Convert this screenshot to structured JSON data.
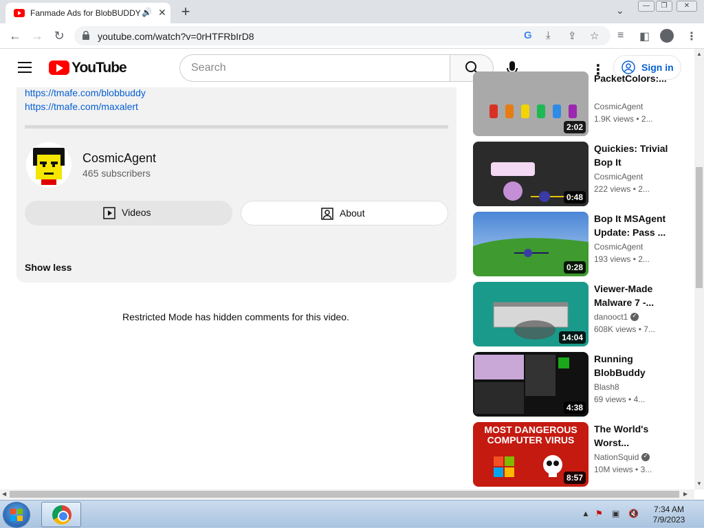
{
  "browser": {
    "tab_title": "Fanmade Ads for BlobBUDDY",
    "url": "youtube.com/watch?v=0rHTFRbIrD8",
    "new_tab_glyph": "+",
    "tab_close_glyph": "✕",
    "tab_audio_glyph": "🔊"
  },
  "youtube": {
    "logo_text": "YouTube",
    "search_placeholder": "Search",
    "signin_label": "Sign in"
  },
  "description": {
    "links": [
      "https://tmafe.com/blobbuddy",
      "https://tmafe.com/maxalert"
    ],
    "channel_name": "CosmicAgent",
    "subscribers": "465 subscribers",
    "videos_label": "Videos",
    "about_label": "About",
    "show_less_label": "Show less"
  },
  "comments": {
    "restricted_message": "Restricted Mode has hidden comments for this video."
  },
  "recommendations": [
    {
      "title": "PacketColors:...",
      "channel": "CosmicAgent",
      "views": "1.9K views",
      "age": "2...",
      "duration": "2:02",
      "verified": false
    },
    {
      "title": "Quickies: Trivial Bop It",
      "channel": "CosmicAgent",
      "views": "222 views",
      "age": "2...",
      "duration": "0:48",
      "verified": false
    },
    {
      "title": "Bop It MSAgent Update: Pass ...",
      "channel": "CosmicAgent",
      "views": "193 views",
      "age": "2...",
      "duration": "0:28",
      "verified": false
    },
    {
      "title": "Viewer-Made Malware 7 -...",
      "channel": "danooct1",
      "views": "608K views",
      "age": "7...",
      "duration": "14:04",
      "verified": true
    },
    {
      "title": "Running BlobBuddy",
      "channel": "Blash8",
      "views": "69 views",
      "age": "4...",
      "duration": "4:38",
      "verified": false
    },
    {
      "title": "The World's Worst...",
      "channel": "NationSquid",
      "views": "10M views",
      "age": "3...",
      "duration": "8:57",
      "verified": true,
      "thumb_text": "MOST DANGEROUS COMPUTER VIRUS"
    }
  ],
  "taskbar": {
    "time": "7:34 AM",
    "date": "7/9/2023"
  },
  "colors": {
    "link_blue": "#065fd4",
    "yt_red": "#ff0000",
    "panel_bg": "#f2f2f2"
  }
}
